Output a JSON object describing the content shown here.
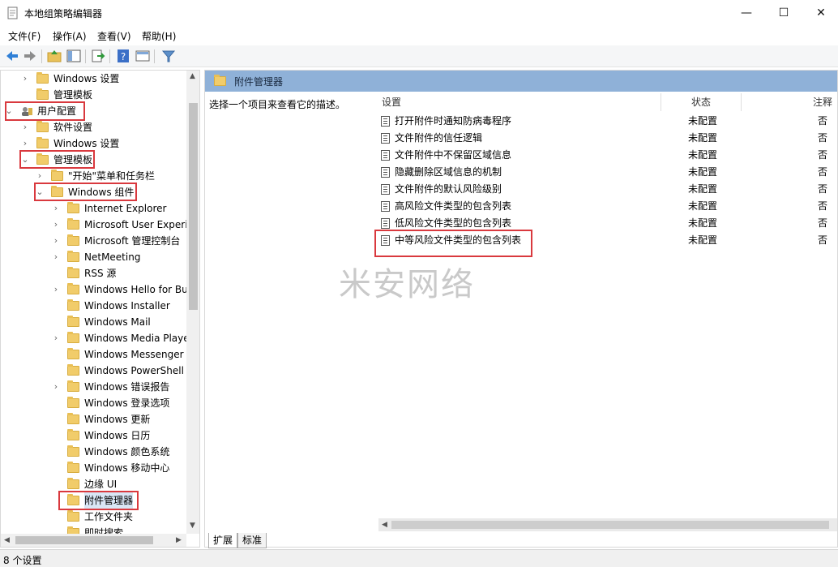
{
  "window": {
    "title": "本地组策略编辑器",
    "minimize": "—",
    "maximize": "☐",
    "close": "✕"
  },
  "menu": [
    "文件(F)",
    "操作(A)",
    "查看(V)",
    "帮助(H)"
  ],
  "tree": [
    {
      "label": "Windows 设置",
      "chevron": "›",
      "depth": 2
    },
    {
      "label": "管理模板",
      "chevron": "",
      "depth": 2
    },
    {
      "label": "用户配置",
      "chevron": "⌄",
      "depth": 0,
      "icon": "user-config-icon"
    },
    {
      "label": "软件设置",
      "chevron": "›",
      "depth": 1
    },
    {
      "label": "Windows 设置",
      "chevron": "›",
      "depth": 1
    },
    {
      "label": "管理模板",
      "chevron": "⌄",
      "depth": 1
    },
    {
      "label": "\"开始\"菜单和任务栏",
      "chevron": "›",
      "depth": 2
    },
    {
      "label": "Windows 组件",
      "chevron": "⌄",
      "depth": 2
    },
    {
      "label": "Internet Explorer",
      "chevron": "›",
      "depth": 3
    },
    {
      "label": "Microsoft User Experi",
      "chevron": "›",
      "depth": 3
    },
    {
      "label": "Microsoft 管理控制台",
      "chevron": "›",
      "depth": 3
    },
    {
      "label": "NetMeeting",
      "chevron": "›",
      "depth": 3
    },
    {
      "label": "RSS 源",
      "chevron": "",
      "depth": 3
    },
    {
      "label": "Windows Hello for Bu",
      "chevron": "›",
      "depth": 3
    },
    {
      "label": "Windows Installer",
      "chevron": "",
      "depth": 3
    },
    {
      "label": "Windows Mail",
      "chevron": "",
      "depth": 3
    },
    {
      "label": "Windows Media Playe",
      "chevron": "›",
      "depth": 3
    },
    {
      "label": "Windows Messenger",
      "chevron": "",
      "depth": 3
    },
    {
      "label": "Windows PowerShell",
      "chevron": "",
      "depth": 3
    },
    {
      "label": "Windows 错误报告",
      "chevron": "›",
      "depth": 3
    },
    {
      "label": "Windows 登录选项",
      "chevron": "",
      "depth": 3
    },
    {
      "label": "Windows 更新",
      "chevron": "",
      "depth": 3
    },
    {
      "label": "Windows 日历",
      "chevron": "",
      "depth": 3
    },
    {
      "label": "Windows 颜色系统",
      "chevron": "",
      "depth": 3
    },
    {
      "label": "Windows 移动中心",
      "chevron": "",
      "depth": 3
    },
    {
      "label": "边缘 UI",
      "chevron": "",
      "depth": 3
    },
    {
      "label": "附件管理器",
      "chevron": "",
      "depth": 3,
      "selected": true
    },
    {
      "label": "工作文件夹",
      "chevron": "",
      "depth": 3
    },
    {
      "label": "即时搜索",
      "chevron": "",
      "depth": 3
    }
  ],
  "right_pane": {
    "header": "附件管理器",
    "description": "选择一个项目来查看它的描述。",
    "columns": {
      "setting": "设置",
      "state": "状态",
      "note": "注释"
    },
    "rows": [
      {
        "setting": "打开附件时通知防病毒程序",
        "state": "未配置",
        "note": "否"
      },
      {
        "setting": "文件附件的信任逻辑",
        "state": "未配置",
        "note": "否"
      },
      {
        "setting": "文件附件中不保留区域信息",
        "state": "未配置",
        "note": "否"
      },
      {
        "setting": "隐藏删除区域信息的机制",
        "state": "未配置",
        "note": "否"
      },
      {
        "setting": "文件附件的默认风险级别",
        "state": "未配置",
        "note": "否"
      },
      {
        "setting": "高风险文件类型的包含列表",
        "state": "未配置",
        "note": "否"
      },
      {
        "setting": "低风险文件类型的包含列表",
        "state": "未配置",
        "note": "否"
      },
      {
        "setting": "中等风险文件类型的包含列表",
        "state": "未配置",
        "note": "否"
      }
    ]
  },
  "tabs": [
    "扩展",
    "标准"
  ],
  "status": "8 个设置",
  "watermark": "米安网络",
  "colors": {
    "header_blue": "#8fb1d8",
    "highlight_red": "#d9393e",
    "folder_yellow": "#f1cc6a"
  }
}
